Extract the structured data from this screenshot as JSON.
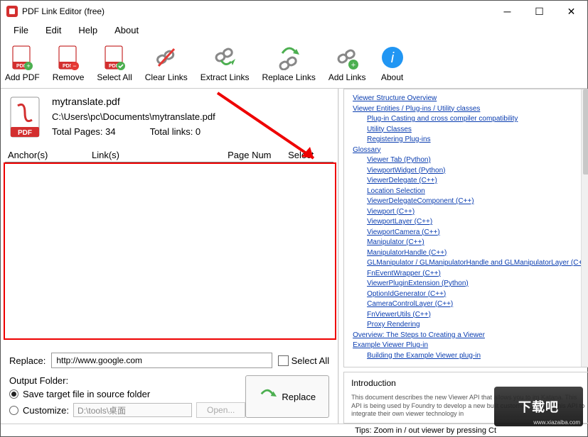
{
  "window": {
    "title": "PDF Link Editor (free)"
  },
  "menu": {
    "file": "File",
    "edit": "Edit",
    "help": "Help",
    "about": "About"
  },
  "toolbar": {
    "add": "Add PDF",
    "remove": "Remove",
    "selectall": "Select All",
    "clear": "Clear Links",
    "extract": "Extract Links",
    "replace": "Replace Links",
    "addlinks": "Add Links",
    "about": "About"
  },
  "file": {
    "name": "mytranslate.pdf",
    "path": "C:\\Users\\pc\\Documents\\mytranslate.pdf",
    "pages_label": "Total Pages: 34",
    "links_label": "Total links: 0"
  },
  "cols": {
    "anchor": "Anchor(s)",
    "link": "Link(s)",
    "page": "Page Num",
    "select": "Select"
  },
  "replace_row": {
    "label": "Replace:",
    "value": "http://www.google.com",
    "selectall": "Select All"
  },
  "output": {
    "label": "Output Folder:",
    "opt1": "Save target file in source folder",
    "opt2": "Customize:",
    "custom_path": "D:\\tools\\桌面",
    "open": "Open..."
  },
  "replace_btn": "Replace",
  "rlinks": {
    "items": [
      {
        "lvl": 1,
        "t": "Viewer Structure Overview"
      },
      {
        "lvl": 1,
        "t": "Viewer Entities / Plug-ins / Utility classes"
      },
      {
        "lvl": 2,
        "t": "Plug-in Casting and cross compiler compatibility"
      },
      {
        "lvl": 2,
        "t": "Utility Classes"
      },
      {
        "lvl": 2,
        "t": "Registering Plug-ins"
      },
      {
        "lvl": 1,
        "t": "Glossary"
      },
      {
        "lvl": 2,
        "t": "Viewer Tab (Python)"
      },
      {
        "lvl": 2,
        "t": "ViewportWidget (Python)"
      },
      {
        "lvl": 2,
        "t": "ViewerDelegate (C++)"
      },
      {
        "lvl": 2,
        "t": "Location Selection"
      },
      {
        "lvl": 2,
        "t": "ViewerDelegateComponent (C++)"
      },
      {
        "lvl": 2,
        "t": "Viewport (C++)"
      },
      {
        "lvl": 2,
        "t": "ViewportLayer (C++)"
      },
      {
        "lvl": 2,
        "t": "ViewportCamera (C++)"
      },
      {
        "lvl": 2,
        "t": "Manipulator (C++)"
      },
      {
        "lvl": 2,
        "t": "ManipulatorHandle (C++)"
      },
      {
        "lvl": 2,
        "t": "GLManipulator / GLManipulatorHandle and GLManipulatorLayer (C++)"
      },
      {
        "lvl": 2,
        "t": "FnEventWrapper (C++)"
      },
      {
        "lvl": 2,
        "t": "ViewerPluginExtension (Python)"
      },
      {
        "lvl": 2,
        "t": "OptionIdGenerator (C++)"
      },
      {
        "lvl": 2,
        "t": "CameraControlLayer (C++)"
      },
      {
        "lvl": 2,
        "t": "FnViewerUtils (C++)"
      },
      {
        "lvl": 2,
        "t": "Proxy Rendering"
      },
      {
        "lvl": 1,
        "t": "Overview: The Steps to Creating a Viewer"
      },
      {
        "lvl": 1,
        "t": "Example Viewer Plug-in"
      },
      {
        "lvl": 2,
        "t": "Building the Example Viewer plug-in"
      }
    ]
  },
  "intro": {
    "heading": "Introduction",
    "body": "This document describes the new Viewer API that allows you to im\nKatana. This API is being used by Foundry to develop a new built\ncustomers can use this API to integrate their own viewer technology in"
  },
  "status": {
    "tip": "Tips: Zoom in / out viewer by pressing Ct"
  },
  "wm": {
    "text": "下载吧",
    "url": "www.xiazaiba.com"
  }
}
